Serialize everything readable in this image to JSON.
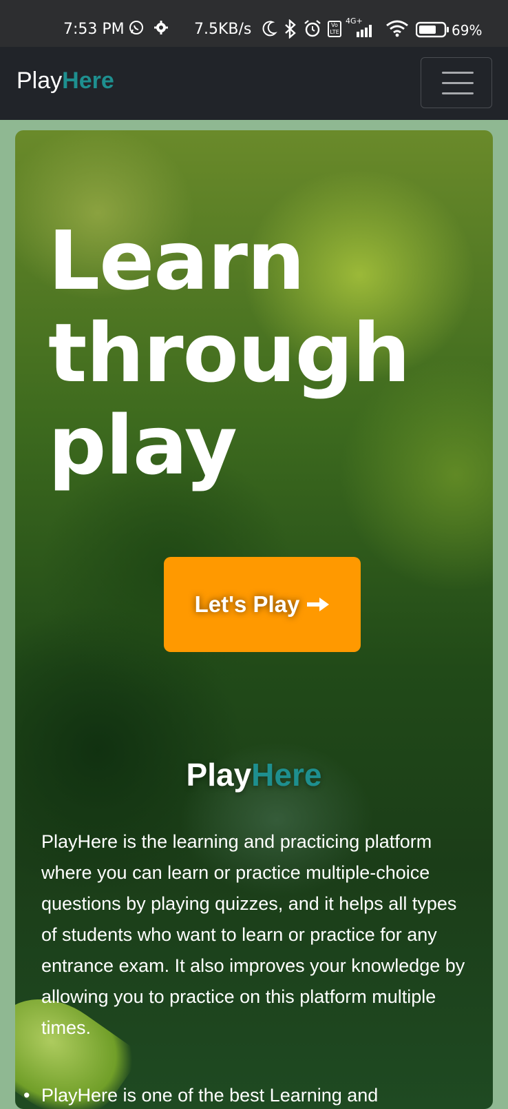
{
  "status_bar": {
    "time": "7:53 PM",
    "network_speed": "7.5KB/s",
    "signal_label": "4G+",
    "volte_label": "Vo LTE",
    "battery": "69%",
    "icons": [
      "whatsapp-icon",
      "settings-icon",
      "moon-icon",
      "bluetooth-icon",
      "alarm-icon",
      "volte-icon",
      "signal-icon",
      "wifi-icon",
      "battery-icon"
    ]
  },
  "navbar": {
    "brand_primary": "Play",
    "brand_accent": "Here",
    "menu_icon": "hamburger-icon"
  },
  "hero": {
    "headline_line1": "Learn",
    "headline_line2": "through",
    "headline_line3": "play",
    "cta_label": "Let's Play",
    "cta_icon": "arrow-right-icon"
  },
  "about": {
    "title_primary": "Play",
    "title_accent": "Here",
    "description": "PlayHere is the learning and practicing platform where you can learn or practice multiple-choice questions by playing quizzes, and it helps all types of students who want to learn or practice for any entrance exam. It also improves your knowledge by allowing you to practice on this platform multiple times.",
    "list_items": [
      "PlayHere is one of the best Learning and"
    ]
  },
  "colors": {
    "accent_teal": "#1e8f8f",
    "cta_orange": "#ff9900",
    "navbar_bg": "#212429"
  }
}
